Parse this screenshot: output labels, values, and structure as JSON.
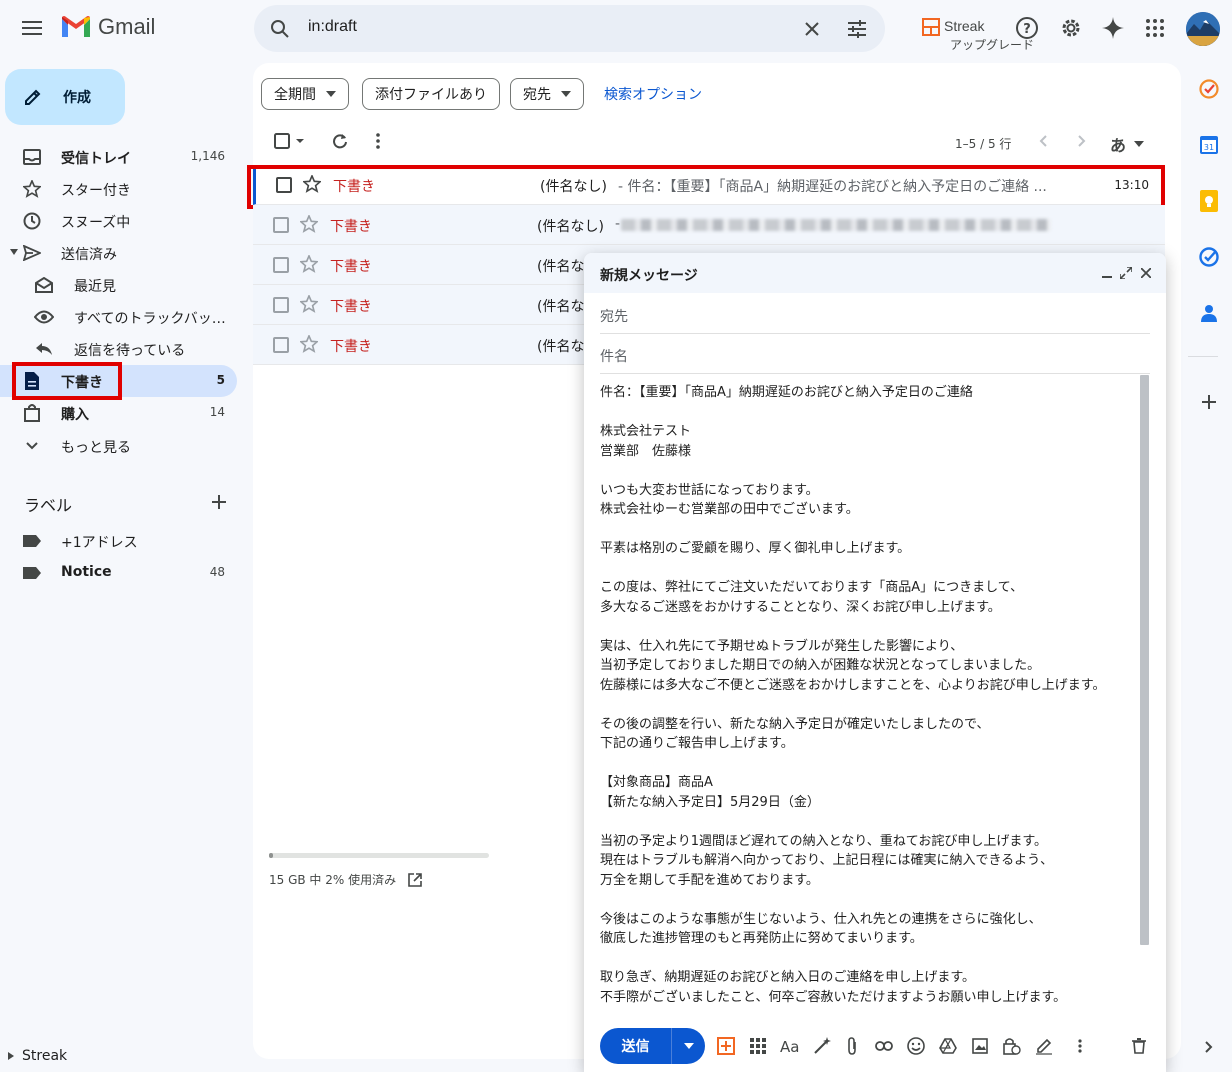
{
  "app": {
    "name": "Gmail"
  },
  "search": {
    "query": "in:draft"
  },
  "streak": {
    "name": "Streak",
    "upgrade": "アップグレード"
  },
  "sidebar": {
    "compose_label": "作成",
    "items": [
      {
        "label": "受信トレイ",
        "count": "1,146"
      },
      {
        "label": "スター付き",
        "count": ""
      },
      {
        "label": "スヌーズ中",
        "count": ""
      },
      {
        "label": "送信済み",
        "count": ""
      },
      {
        "label": "最近見",
        "count": ""
      },
      {
        "label": "すべてのトラックバッ…",
        "count": ""
      },
      {
        "label": "返信を待っている",
        "count": ""
      },
      {
        "label": "下書き",
        "count": "5"
      },
      {
        "label": "購入",
        "count": "14"
      },
      {
        "label": "もっと見る",
        "count": ""
      }
    ],
    "labels_heading": "ラベル",
    "labels": [
      {
        "label": "+1アドレス",
        "count": ""
      },
      {
        "label": "Notice",
        "count": "48"
      }
    ],
    "storage": "15 GB 中 2% 使用済み",
    "storage_fraction": 0.02,
    "streak_footer": "Streak"
  },
  "filters": {
    "chip_period": "全期間",
    "chip_attachment": "添付ファイルあり",
    "chip_to": "宛先",
    "search_options": "検索オプション"
  },
  "toolbar": {
    "pager": "1–5 / 5 行",
    "lang": "あ"
  },
  "mail_list": [
    {
      "label": "下書き",
      "subject": "(件名なし)",
      "snippet": " - 件名：【重要】「商品A」納期遅延のお詫びと納入予定日のご連絡 ...",
      "time": "13:10"
    },
    {
      "label": "下書き",
      "subject": "(件名なし)",
      "snippet": " -",
      "time": ""
    },
    {
      "label": "下書き",
      "subject": "(件名な",
      "snippet": "",
      "time": ""
    },
    {
      "label": "下書き",
      "subject": "(件名な",
      "snippet": "",
      "time": ""
    },
    {
      "label": "下書き",
      "subject": "(件名な",
      "snippet": "",
      "time": ""
    }
  ],
  "compose": {
    "title": "新規メッセージ",
    "to_placeholder": "宛先",
    "subject_placeholder": "件名",
    "send_label": "送信",
    "body": [
      "件名：【重要】「商品A」納期遅延のお詫びと納入予定日のご連絡",
      "",
      "株式会社テスト",
      "営業部　佐藤様",
      "",
      "いつも大変お世話になっております。",
      "株式会社ゆーむ営業部の田中でございます。",
      "",
      "平素は格別のご愛顧を賜り、厚く御礼申し上げます。",
      "",
      "この度は、弊社にてご注文いただいております「商品A」につきまして、",
      "多大なるご迷惑をおかけすることとなり、深くお詫び申し上げます。",
      "",
      "実は、仕入れ先にて予期せぬトラブルが発生した影響により、",
      "当初予定しておりました期日での納入が困難な状況となってしまいました。",
      "佐藤様には多大なご不便とご迷惑をおかけしますことを、心よりお詫び申し上げます。",
      "",
      "その後の調整を行い、新たな納入予定日が確定いたしましたので、",
      "下記の通りご報告申し上げます。",
      "",
      "【対象商品】商品A",
      "【新たな納入予定日】5月29日（金）",
      "",
      "当初の予定より1週間ほど遅れての納入となり、重ねてお詫び申し上げます。",
      "現在はトラブルも解消へ向かっており、上記日程には確実に納入できるよう、",
      "万全を期して手配を進めております。",
      "",
      "今後はこのような事態が生じないよう、仕入れ先との連携をさらに強化し、",
      "徹底した進捗管理のもと再発防止に努めてまいります。",
      "",
      "取り急ぎ、納期遅延のお詫びと納入日のご連絡を申し上げます。",
      "不手際がございましたこと、何卒ご容赦いただけますようお願い申し上げます。"
    ]
  },
  "colors": {
    "accent": "#0b57d0",
    "draft_red": "#c5221f",
    "highlight": "#e00000",
    "compose_bg": "#c2e7ff",
    "active_nav": "#d3e3fd"
  }
}
